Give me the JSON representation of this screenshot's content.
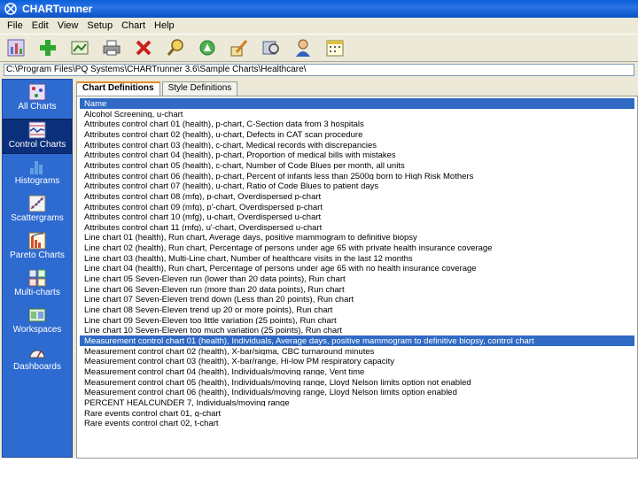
{
  "window": {
    "title": "CHARTrunner"
  },
  "menu": [
    "File",
    "Edit",
    "View",
    "Setup",
    "Chart",
    "Help"
  ],
  "toolbar": {
    "buttons": [
      "new-chart-icon",
      "add-icon",
      "image-icon",
      "print-icon",
      "delete-icon",
      "search-icon",
      "run-icon",
      "edit-icon",
      "preview-icon",
      "user-icon",
      "calendar-icon"
    ]
  },
  "path": "C:\\Program Files\\PQ Systems\\CHARTrunner 3.6\\Sample Charts\\Healthcare\\",
  "sidebar": {
    "items": [
      {
        "label": "All Charts"
      },
      {
        "label": "Control Charts"
      },
      {
        "label": "Histograms"
      },
      {
        "label": "Scattergrams"
      },
      {
        "label": "Pareto Charts"
      },
      {
        "label": "Multi-charts"
      },
      {
        "label": "Workspaces"
      },
      {
        "label": "Dashboards"
      }
    ]
  },
  "tabs": [
    "Chart Definitions",
    "Style Definitions"
  ],
  "list": {
    "header": "Name",
    "rows": [
      "Alcohol Screening, u-chart",
      "Attributes control chart 01 (health), p-chart, C-Section data from 3 hospitals",
      "Attributes control chart 02 (health), u-chart, Defects in CAT scan procedure",
      "Attributes control chart 03 (health), c-chart, Medical records with discrepancies",
      "Attributes control chart 04 (health), p-chart, Proportion of medical bills with mistakes",
      "Attributes control chart 05 (health), c-chart, Number of Code Blues per month, all units",
      "Attributes control chart 06 (health), p-chart, Percent of infants less than 2500g born to High Risk Mothers",
      "Attributes control chart 07 (health), u-chart, Ratio of Code Blues to patient days",
      "Attributes control chart 08 (mfg), p-chart, Overdispersed p-chart",
      "Attributes control chart 09 (mfg), p'-chart, Overdispersed p-chart",
      "Attributes control chart 10 (mfg), u-chart, Overdispersed u-chart",
      "Attributes control chart 11 (mfg), u'-chart, Overdispersed u-chart",
      "Line chart 01 (health), Run chart, Average days, positive mammogram to definitive biopsy",
      "Line chart 02 (health), Run chart, Percentage of persons under age 65 with private health insurance coverage",
      "Line chart 03 (health), Multi-Line chart, Number of healthcare visits in the last 12 months",
      "Line chart 04 (health), Run chart, Percentage of persons under age 65 with no health insurance coverage",
      "Line chart 05 Seven-Eleven run (lower than 20 data points), Run chart",
      "Line chart 06 Seven-Eleven run (more than 20 data points), Run chart",
      "Line chart 07 Seven-Eleven trend down (Less than 20 points), Run chart",
      "Line chart 08 Seven-Eleven trend up 20 or more points), Run chart",
      "Line chart 09 Seven-Eleven too little variation (25 points), Run chart",
      "Line chart 10 Seven-Eleven too much variation (25 points), Run chart",
      "Measurement control chart 01 (health), Individuals, Average days, positive mammogram to definitive biopsy, control chart",
      "Measurement control chart 02 (health), X-bar/sigma, CBC turnaround minutes",
      "Measurement control chart 03 (health), X-bar/range, Hi-low PM respiratory capacity",
      "Measurement control chart 04 (health), Individuals/moving range, Vent time",
      "Measurement control chart 05 (health), Individuals/moving range, Lloyd Nelson limits option not enabled",
      "Measurement control chart 06 (health), Individuals/moving range, Lloyd Nelson limits option enabled",
      "PERCENT HEALCUNDER 7, Individuals/moving range",
      "Rare events control chart 01, g-chart",
      "Rare events control chart 02, t-chart"
    ],
    "selected_index": 22
  },
  "colors": {
    "titlebar": "#0b51c4",
    "sidebar": "#2e6bd1",
    "selection": "#316ac5"
  }
}
